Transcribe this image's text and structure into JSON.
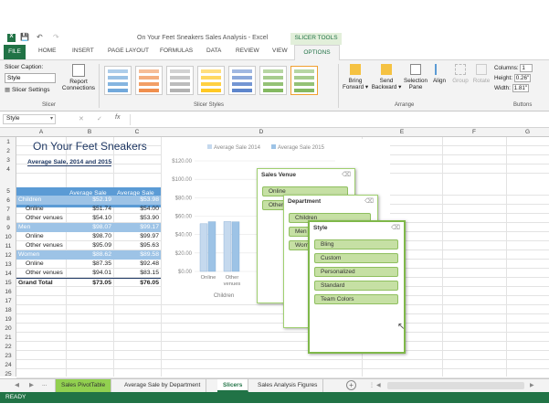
{
  "window": {
    "title": "On Your Feet Sneakers Sales Analysis - Excel",
    "context_tab": "SLICER TOOLS"
  },
  "tabs": [
    "FILE",
    "HOME",
    "INSERT",
    "PAGE LAYOUT",
    "FORMULAS",
    "DATA",
    "REVIEW",
    "VIEW",
    "OPTIONS"
  ],
  "ribbon": {
    "slicer_caption_label": "Slicer Caption:",
    "slicer_caption_value": "Style",
    "slicer_settings": "Slicer Settings",
    "report_connections": [
      "Report",
      "Connections"
    ],
    "group_slicer": "Slicer",
    "group_styles": "Slicer Styles",
    "bring_forward": [
      "Bring",
      "Forward ▾"
    ],
    "send_backward": [
      "Send",
      "Backward ▾"
    ],
    "selection_pane": [
      "Selection",
      "Pane"
    ],
    "align": "Align",
    "group": "Group",
    "rotate": "Rotate",
    "group_arrange": "Arrange",
    "columns_label": "Columns:",
    "columns_value": "1",
    "height_label": "Height:",
    "height_value": "0.26\"",
    "width_label": "Width:",
    "width_value": "1.81\"",
    "group_buttons": "Buttons"
  },
  "formula_bar": {
    "namebox": "Style",
    "fx": "fx"
  },
  "columns": [
    "A",
    "B",
    "C",
    "D",
    "E",
    "F",
    "G"
  ],
  "rows": [
    "1",
    "2",
    "3",
    "4",
    "5",
    "6",
    "7",
    "8",
    "9",
    "10",
    "11",
    "12",
    "13",
    "14",
    "15",
    "16",
    "17",
    "18",
    "19",
    "20",
    "21",
    "22",
    "23",
    "24",
    "25",
    "26"
  ],
  "sheet": {
    "title": "On Your Feet Sneakers",
    "subtitle": "Average Sale, 2014 and 2015",
    "hdr_b": [
      "Average Sale",
      "2014"
    ],
    "hdr_c": [
      "Average Sale",
      "2015"
    ],
    "rows": [
      {
        "a": "Children",
        "b": "$52.19",
        "c": "$53.98",
        "style": "group"
      },
      {
        "a": "Online",
        "b": "$51.74",
        "c": "$54.00",
        "style": "item"
      },
      {
        "a": "Other venues",
        "b": "$54.10",
        "c": "$53.90",
        "style": "item"
      },
      {
        "a": "Men",
        "b": "$98.07",
        "c": "$99.17",
        "style": "group"
      },
      {
        "a": "Online",
        "b": "$98.70",
        "c": "$99.97",
        "style": "item"
      },
      {
        "a": "Other venues",
        "b": "$95.09",
        "c": "$95.63",
        "style": "item"
      },
      {
        "a": "Women",
        "b": "$88.62",
        "c": "$89.58",
        "style": "group"
      },
      {
        "a": "Online",
        "b": "$87.35",
        "c": "$92.48",
        "style": "item"
      },
      {
        "a": "Other venues",
        "b": "$94.01",
        "c": "$83.15",
        "style": "item"
      },
      {
        "a": "Grand Total",
        "b": "$73.05",
        "c": "$76.05",
        "style": "total"
      }
    ]
  },
  "chart_data": {
    "type": "bar",
    "categories": [
      "Online",
      "Other venues"
    ],
    "category_group": "Children",
    "series": [
      {
        "name": "Average Sale 2014",
        "values": [
          51.74,
          54.1
        ],
        "color": "#c5d9ee"
      },
      {
        "name": "Average Sale 2015",
        "values": [
          54.0,
          53.9
        ],
        "color": "#9dc3e6"
      }
    ],
    "yticks": [
      "$120.00",
      "$100.00",
      "$80.00",
      "$60.00",
      "$40.00",
      "$20.00",
      "$0.00"
    ],
    "ylim": [
      0,
      120
    ],
    "legend": "top"
  },
  "slicers": {
    "venue": {
      "title": "Sales Venue",
      "items": [
        "Online",
        "Other venues"
      ]
    },
    "department": {
      "title": "Department",
      "items": [
        "Children",
        "Men",
        "Women"
      ]
    },
    "style": {
      "title": "Style",
      "items": [
        "Bling",
        "Custom",
        "Personalized",
        "Standard",
        "Team Colors"
      ]
    }
  },
  "sheet_tabs": [
    "Sales PivotTable",
    "Average Sale by Department",
    "Slicers",
    "Sales Analysis Figures"
  ],
  "status": "READY",
  "colors": {
    "excel_green": "#217346",
    "pivot_blue": "#5b9bd5",
    "slicer_green": "#c6e0a4"
  }
}
